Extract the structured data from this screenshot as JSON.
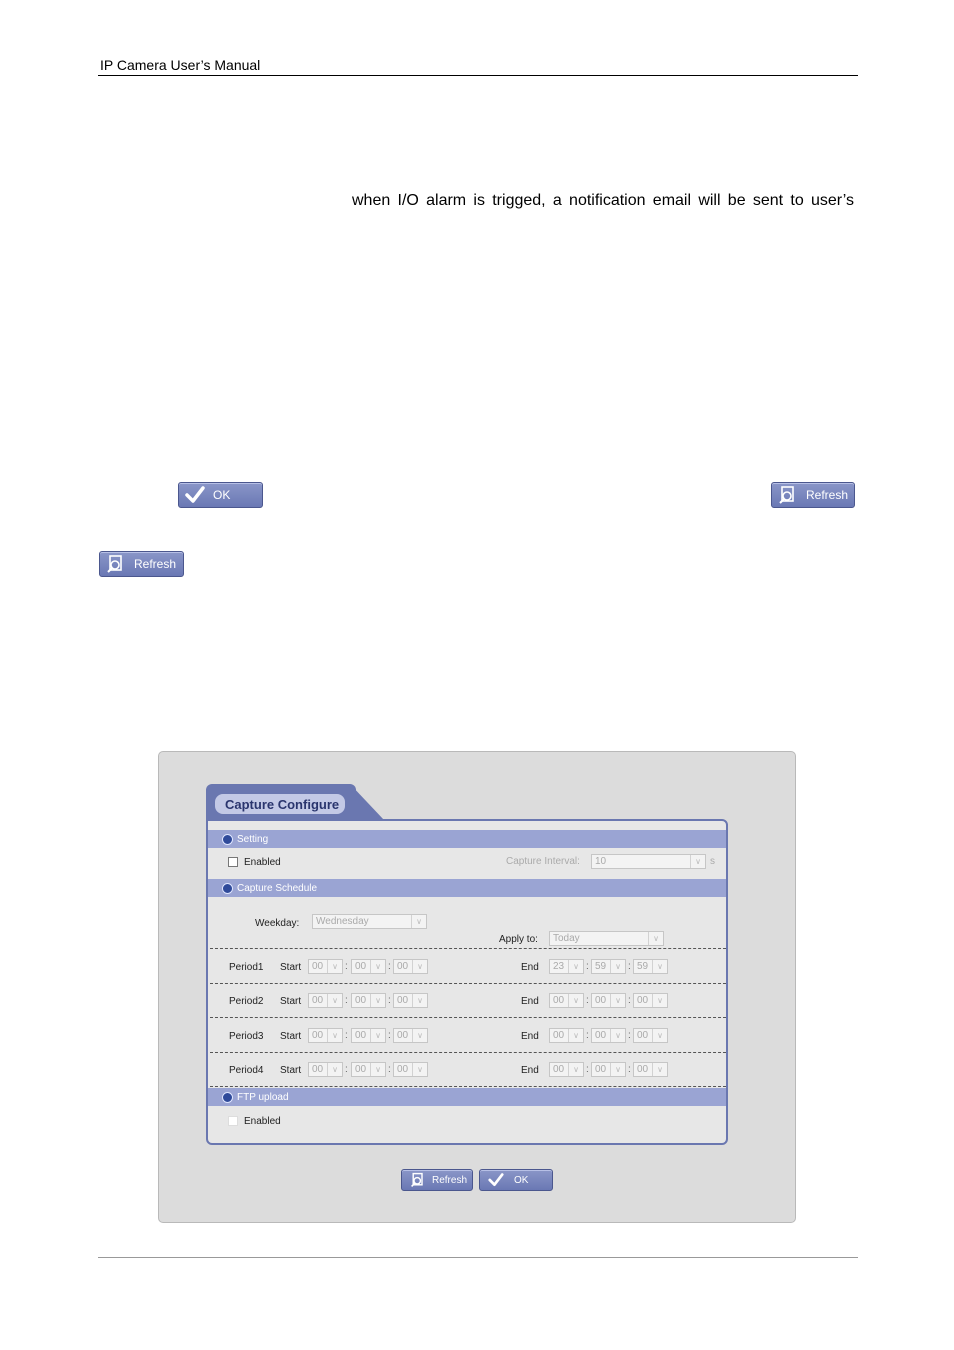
{
  "header": {
    "title": "IP Camera User’s Manual"
  },
  "body_text": "when I/O alarm is trigged, a notification email will be sent to user’s",
  "inline_buttons": {
    "ok": "OK",
    "refresh": "Refresh"
  },
  "capture": {
    "tab_title": "Capture Configure",
    "setting": {
      "title": "Setting",
      "enabled_label": "Enabled",
      "interval_label": "Capture Interval:",
      "interval_value": "10",
      "interval_unit": "s"
    },
    "schedule": {
      "title": "Capture Schedule",
      "weekday_label": "Weekday:",
      "weekday_value": "Wednesday",
      "apply_label": "Apply to:",
      "apply_value": "Today",
      "start_label": "Start",
      "end_label": "End",
      "periods": [
        {
          "name": "Period1",
          "start": [
            "00",
            "00",
            "00"
          ],
          "end": [
            "23",
            "59",
            "59"
          ]
        },
        {
          "name": "Period2",
          "start": [
            "00",
            "00",
            "00"
          ],
          "end": [
            "00",
            "00",
            "00"
          ]
        },
        {
          "name": "Period3",
          "start": [
            "00",
            "00",
            "00"
          ],
          "end": [
            "00",
            "00",
            "00"
          ]
        },
        {
          "name": "Period4",
          "start": [
            "00",
            "00",
            "00"
          ],
          "end": [
            "00",
            "00",
            "00"
          ]
        }
      ]
    },
    "ftp": {
      "title": "FTP upload",
      "enabled_label": "Enabled"
    },
    "buttons": {
      "refresh": "Refresh",
      "ok": "OK"
    }
  }
}
